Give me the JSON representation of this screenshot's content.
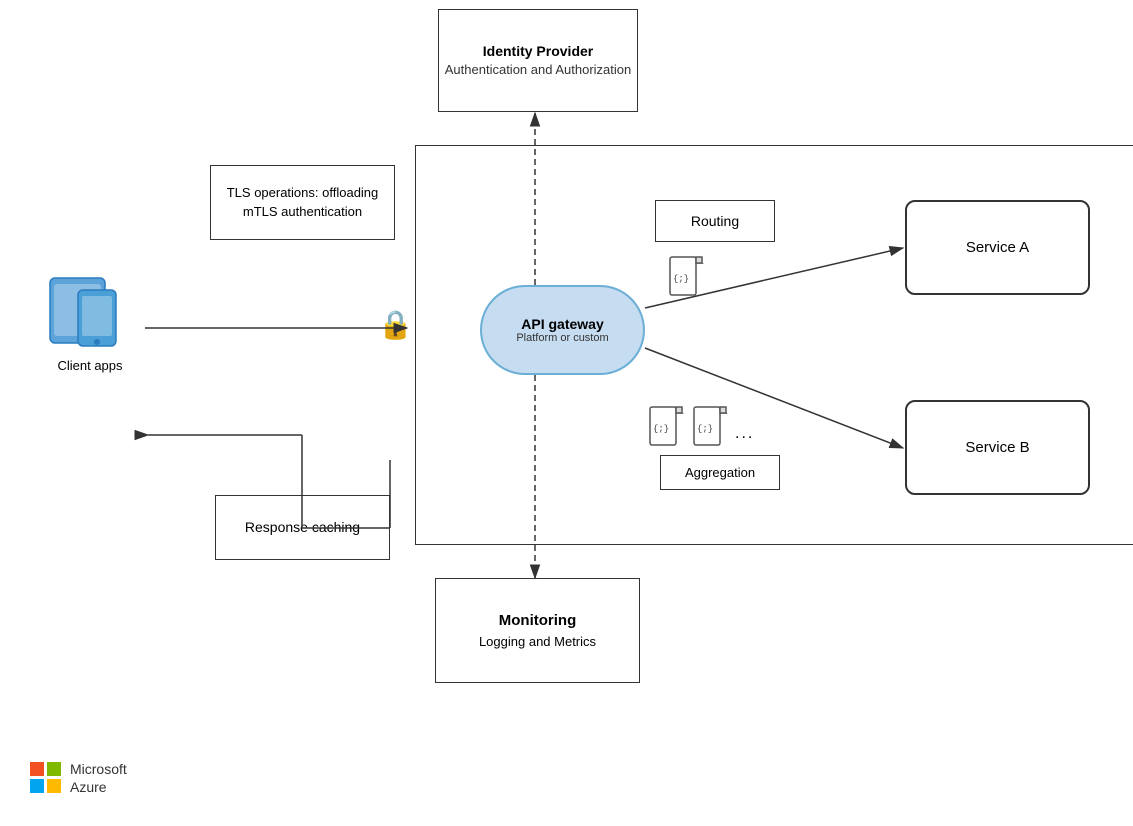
{
  "identity": {
    "line1": "Identity Provider",
    "line2": "Authentication and Authorization"
  },
  "tls": {
    "label": "TLS operations: offloading mTLS authentication"
  },
  "api_gateway": {
    "title": "API gateway",
    "subtitle": "Platform or custom"
  },
  "routing": {
    "label": "Routing"
  },
  "service_a": {
    "label": "Service A"
  },
  "service_b": {
    "label": "Service B"
  },
  "aggregation": {
    "label": "Aggregation"
  },
  "response": {
    "label": "Response caching"
  },
  "monitoring": {
    "line1": "Monitoring",
    "line2": "Logging and Metrics"
  },
  "client": {
    "label": "Client apps"
  },
  "azure": {
    "line1": "Microsoft",
    "line2": "Azure"
  }
}
